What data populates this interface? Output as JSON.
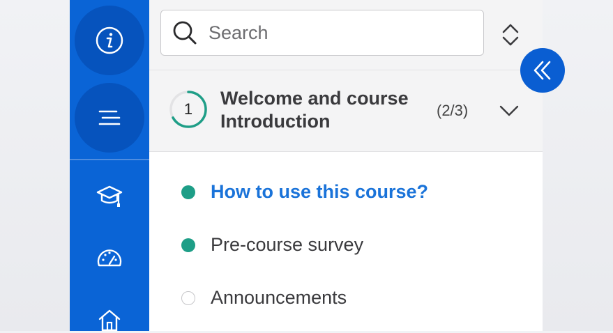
{
  "rail": {
    "items": [
      {
        "icon": "info-icon"
      },
      {
        "icon": "menu-lines-icon"
      },
      {
        "icon": "graduation-cap-icon"
      },
      {
        "icon": "speedometer-icon"
      },
      {
        "icon": "home-icon"
      }
    ]
  },
  "search": {
    "placeholder": "Search"
  },
  "module": {
    "number": "1",
    "title_line1": "Welcome and course",
    "title_line2": "Introduction",
    "count": "(2/3)",
    "progress": 0.67
  },
  "lessons": [
    {
      "label": "How to use this course?",
      "status": "done",
      "active": true
    },
    {
      "label": "Pre-course survey",
      "status": "done",
      "active": false
    },
    {
      "label": "Announcements",
      "status": "todo",
      "active": false
    }
  ],
  "colors": {
    "rail": "#0a64d6",
    "accent": "#1a73d9",
    "complete": "#1e9e87"
  }
}
